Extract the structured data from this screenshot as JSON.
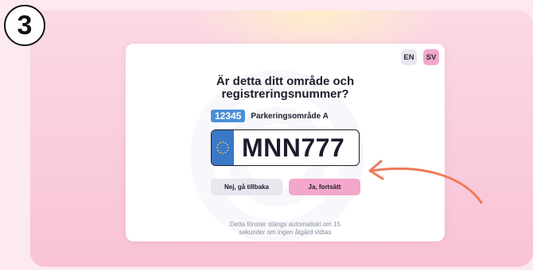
{
  "step": {
    "number": "3"
  },
  "dialog": {
    "languages": [
      {
        "code": "EN",
        "active": false
      },
      {
        "code": "SV",
        "active": true
      }
    ],
    "title_lines": [
      "Är detta ditt område och",
      "registreringsnummer?"
    ],
    "zone": {
      "code": "12345",
      "name": "Parkeringsområde A"
    },
    "plate": {
      "number": "MNN777"
    },
    "buttons": {
      "back_label": "Nej, gå tillbaka",
      "continue_label": "Ja, fortsätt"
    },
    "footer_lines": [
      "Detta fönster stängs automatiskt om 15",
      "sekunder om ingen åtgärd vidtas"
    ]
  },
  "colors": {
    "page_bg": "#fde9f0",
    "panel_bg": "#f8c3d6",
    "accent_pink": "#f2a7cb",
    "neutral_button": "#e6e7ef",
    "zone_blue": "#4a8fd6",
    "plate_band": "#3a78c8",
    "arrow": "#ee7a5a"
  },
  "icons": [
    "eu-stars-icon",
    "curved-arrow-icon",
    "watermark-logo"
  ]
}
